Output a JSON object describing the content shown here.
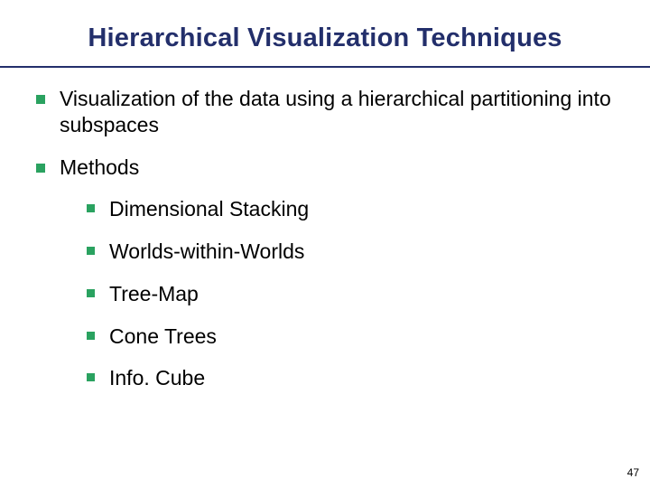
{
  "title": "Hierarchical Visualization Techniques",
  "bullets": {
    "intro": "Visualization of the data using a hierarchical partitioning into subspaces",
    "methods_label": "Methods",
    "methods": [
      "Dimensional Stacking",
      "Worlds-within-Worlds",
      "Tree-Map",
      "Cone Trees",
      "Info. Cube"
    ]
  },
  "page_number": "47",
  "colors": {
    "title_navy": "#232f6b",
    "bullet_green": "#2aa260"
  }
}
